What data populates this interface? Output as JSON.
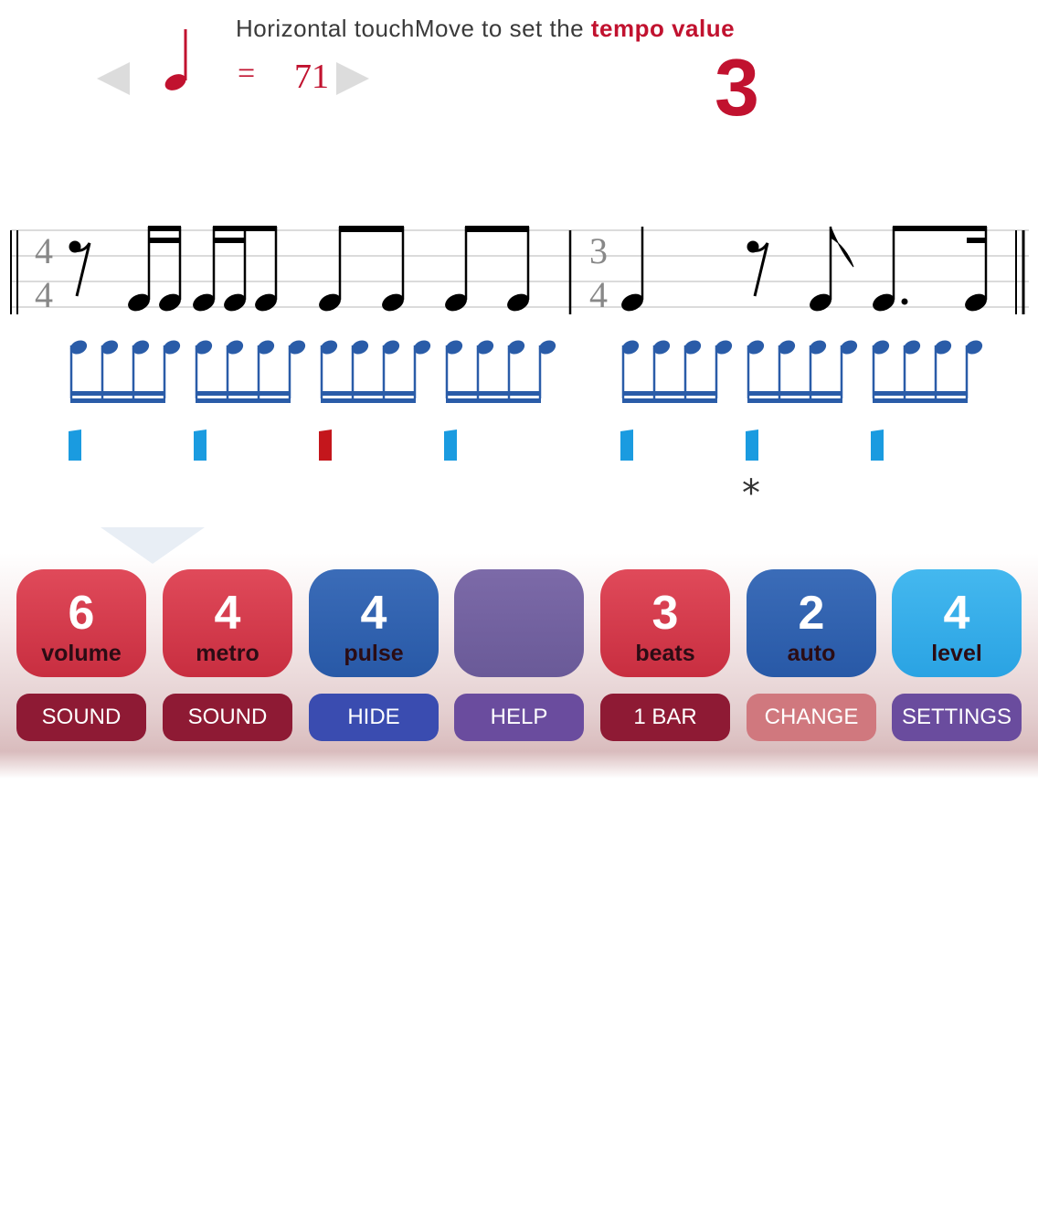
{
  "header": {
    "instruction_prefix": "Horizontal touchMove to set the ",
    "instruction_emphasis": "tempo value",
    "tempo_equals": "=",
    "tempo_value": "71",
    "count_display": "3"
  },
  "score": {
    "bar1_time_signature": {
      "top": "4",
      "bottom": "4"
    },
    "bar2_time_signature": {
      "top": "3",
      "bottom": "4"
    },
    "accent_marker": "*"
  },
  "buttons": [
    {
      "number": "6",
      "label": "volume",
      "sub_label": "SOUND"
    },
    {
      "number": "4",
      "label": "metro",
      "sub_label": "SOUND"
    },
    {
      "number": "4",
      "label": "pulse",
      "sub_label": "HIDE"
    },
    {
      "number": "",
      "label": "",
      "sub_label": "HELP"
    },
    {
      "number": "3",
      "label": "beats",
      "sub_label": "1 BAR"
    },
    {
      "number": "2",
      "label": "auto",
      "sub_label": "CHANGE"
    },
    {
      "number": "4",
      "label": "level",
      "sub_label": "SETTINGS"
    }
  ],
  "colors": {
    "accent_red": "#c1122f",
    "note_blue": "#2a5ca8",
    "pulse_blue": "#1a9be0",
    "pulse_active": "#c4161c"
  }
}
